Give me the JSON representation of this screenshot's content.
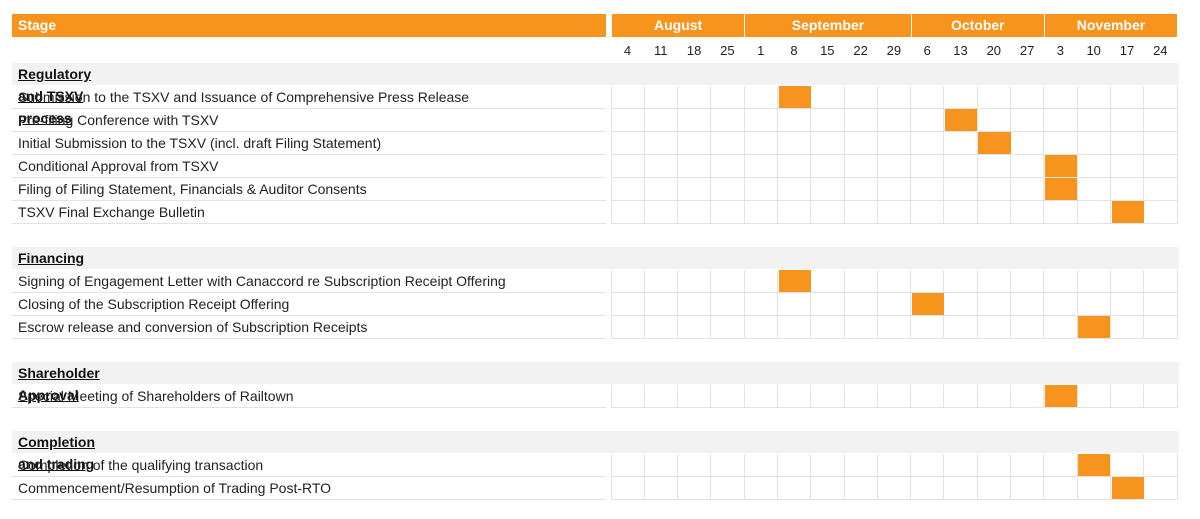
{
  "chart_data": {
    "type": "gantt",
    "stage_header": "Stage",
    "months": [
      {
        "name": "August",
        "span": 4
      },
      {
        "name": "September",
        "span": 5
      },
      {
        "name": "October",
        "span": 4
      },
      {
        "name": "November",
        "span": 4
      }
    ],
    "weeks": [
      "4",
      "11",
      "18",
      "25",
      "1",
      "8",
      "15",
      "22",
      "29",
      "6",
      "13",
      "20",
      "27",
      "3",
      "10",
      "17",
      "24"
    ],
    "sections": [
      {
        "title": "Regulatory and TSXV process",
        "tasks": [
          {
            "label": "Submission to the TSXV and Issuance of Comprehensive Press Release",
            "week": "8",
            "month": "September"
          },
          {
            "label": "Pre-filing Conference with TSXV",
            "week": "13",
            "month": "October"
          },
          {
            "label": "Initial Submission to the TSXV (incl. draft Filing Statement)",
            "week": "20",
            "month": "October"
          },
          {
            "label": "Conditional Approval from TSXV",
            "week": "3",
            "month": "November"
          },
          {
            "label": "Filing of Filing Statement, Financials & Auditor Consents",
            "week": "3",
            "month": "November"
          },
          {
            "label": "TSXV Final Exchange Bulletin",
            "week": "17",
            "month": "November"
          }
        ]
      },
      {
        "title": "Financing",
        "tasks": [
          {
            "label": "Signing of Engagement Letter with Canaccord re Subscription Receipt Offering",
            "week": "8",
            "month": "September"
          },
          {
            "label": "Closing of the Subscription Receipt Offering",
            "week": "6",
            "month": "October"
          },
          {
            "label": "Escrow release and conversion of Subscription Receipts",
            "week": "10",
            "month": "November"
          }
        ]
      },
      {
        "title": "Shareholder Approval",
        "tasks": [
          {
            "label": "Special Meeting of Shareholders of Railtown",
            "week": "3",
            "month": "November"
          }
        ]
      },
      {
        "title": "Completion and trading",
        "tasks": [
          {
            "label": "Completion of the qualifying transaction",
            "week": "10",
            "month": "November"
          },
          {
            "label": "Commencement/Resumption of Trading Post-RTO",
            "week": "17",
            "month": "November"
          }
        ]
      }
    ],
    "colors": {
      "accent": "#F7941D",
      "section_bg": "#F2F2F2",
      "grid": "#E3E3E3"
    }
  }
}
